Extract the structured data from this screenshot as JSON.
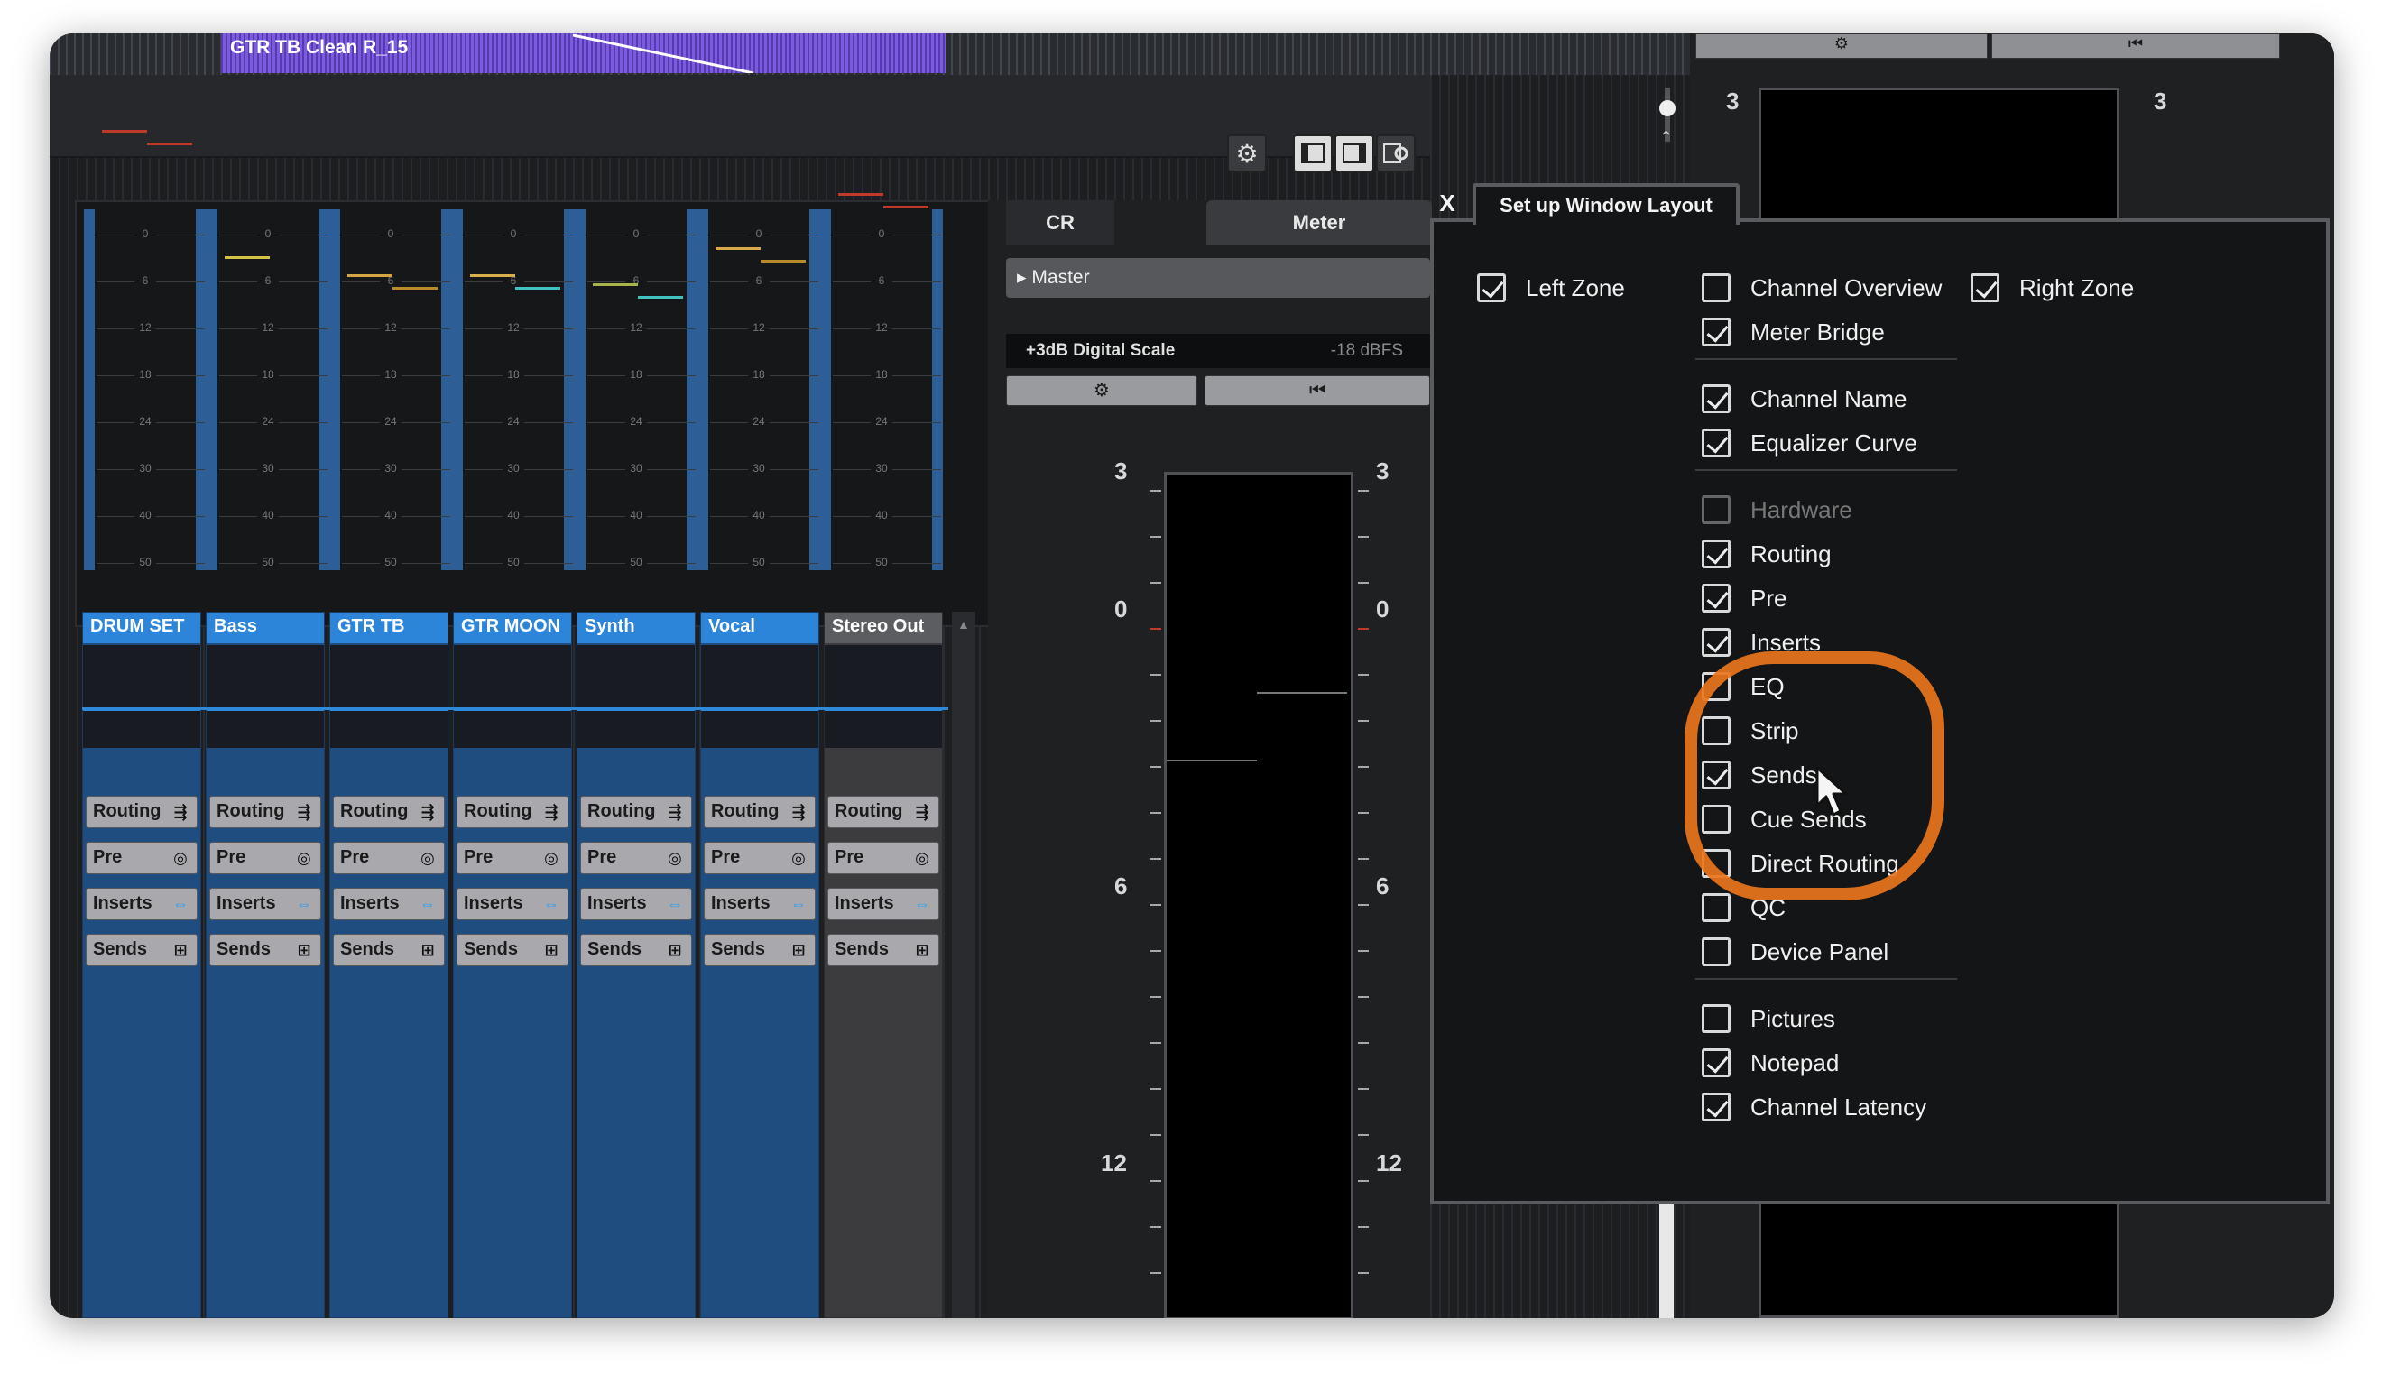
{
  "project": {
    "event_name": "GTR TB Clean R_15"
  },
  "toolbar": {
    "icons": [
      "gear-icon",
      "left-zone-icon",
      "right-zone-icon",
      "window-layout-icon"
    ]
  },
  "meter_bridge": {
    "scale_labels": [
      "0",
      "6",
      "12",
      "18",
      "24",
      "30",
      "40",
      "50"
    ]
  },
  "channels": [
    {
      "name": "DRUM SET",
      "routing": "Routing",
      "pre": "Pre",
      "inserts": "Inserts",
      "sends": "Sends"
    },
    {
      "name": "Bass",
      "routing": "Routing",
      "pre": "Pre",
      "inserts": "Inserts",
      "sends": "Sends"
    },
    {
      "name": "GTR TB",
      "routing": "Routing",
      "pre": "Pre",
      "inserts": "Inserts",
      "sends": "Sends"
    },
    {
      "name": "GTR MOON",
      "routing": "Routing",
      "pre": "Pre",
      "inserts": "Inserts",
      "sends": "Sends"
    },
    {
      "name": "Synth",
      "routing": "Routing",
      "pre": "Pre",
      "inserts": "Inserts",
      "sends": "Sends"
    },
    {
      "name": "Vocal",
      "routing": "Routing",
      "pre": "Pre",
      "inserts": "Inserts",
      "sends": "Sends"
    },
    {
      "name": "Stereo Out",
      "routing": "Routing",
      "pre": "Pre",
      "inserts": "Inserts",
      "sends": "Sends"
    }
  ],
  "right_zone": {
    "tabs": [
      "CR",
      "Meter"
    ],
    "master_label": "Master",
    "scale_name": "+3dB Digital Scale",
    "scale_ref": "-18 dBFS",
    "meter_labels": [
      "3",
      "0",
      "6",
      "12"
    ],
    "far_right_labels": [
      "3",
      "3"
    ]
  },
  "dialog": {
    "title": "Set up Window Layout",
    "close_label": "X",
    "left_options": [
      {
        "label": "Left Zone",
        "checked": true
      }
    ],
    "right_options": [
      {
        "label": "Right Zone",
        "checked": true
      }
    ],
    "middle_groups": [
      [
        {
          "label": "Channel Overview",
          "checked": false
        },
        {
          "label": "Meter Bridge",
          "checked": true
        }
      ],
      [
        {
          "label": "Channel Name",
          "checked": true
        },
        {
          "label": "Equalizer Curve",
          "checked": true
        }
      ],
      [
        {
          "label": "Hardware",
          "checked": false,
          "disabled": true
        },
        {
          "label": "Routing",
          "checked": true
        },
        {
          "label": "Pre",
          "checked": true
        },
        {
          "label": "Inserts",
          "checked": true
        },
        {
          "label": "EQ",
          "checked": false
        },
        {
          "label": "Strip",
          "checked": false
        },
        {
          "label": "Sends",
          "checked": true
        },
        {
          "label": "Cue Sends",
          "checked": false
        },
        {
          "label": "Direct Routing",
          "checked": false
        },
        {
          "label": "QC",
          "checked": false
        },
        {
          "label": "Device Panel",
          "checked": false
        }
      ],
      [
        {
          "label": "Pictures",
          "checked": false
        },
        {
          "label": "Notepad",
          "checked": true
        },
        {
          "label": "Channel Latency",
          "checked": true
        }
      ]
    ]
  },
  "colors": {
    "channel_blue": "#204d80",
    "channel_name_blue": "#2c85d8",
    "audio_event_purple": "#7b5be0",
    "highlight_orange": "#e9751c"
  }
}
